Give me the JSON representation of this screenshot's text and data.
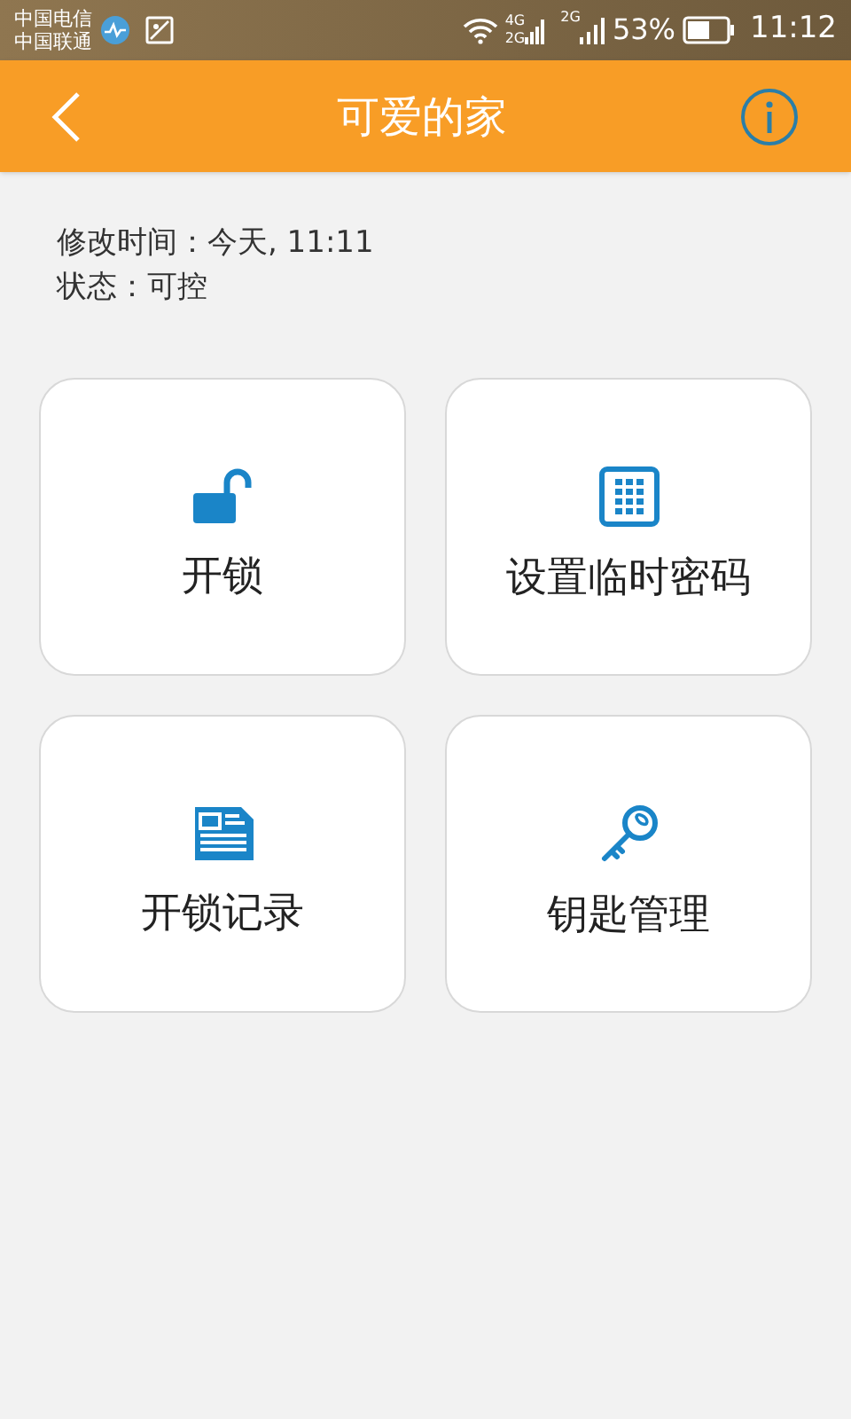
{
  "status_bar": {
    "carriers": [
      "中国电信",
      "中国联通"
    ],
    "network_1": "4G",
    "network_2": "2G",
    "network_3": "2G",
    "battery": "53%",
    "time": "11:12"
  },
  "header": {
    "title": "可爱的家"
  },
  "info": [
    "修改时间：今天, 11:11",
    "状态：可控"
  ],
  "tiles": [
    {
      "kind": "unlock",
      "label": "开锁"
    },
    {
      "kind": "keypad",
      "label": "设置临时密码"
    },
    {
      "kind": "record",
      "label": "开锁记录"
    },
    {
      "kind": "key",
      "label": "钥匙管理"
    }
  ]
}
